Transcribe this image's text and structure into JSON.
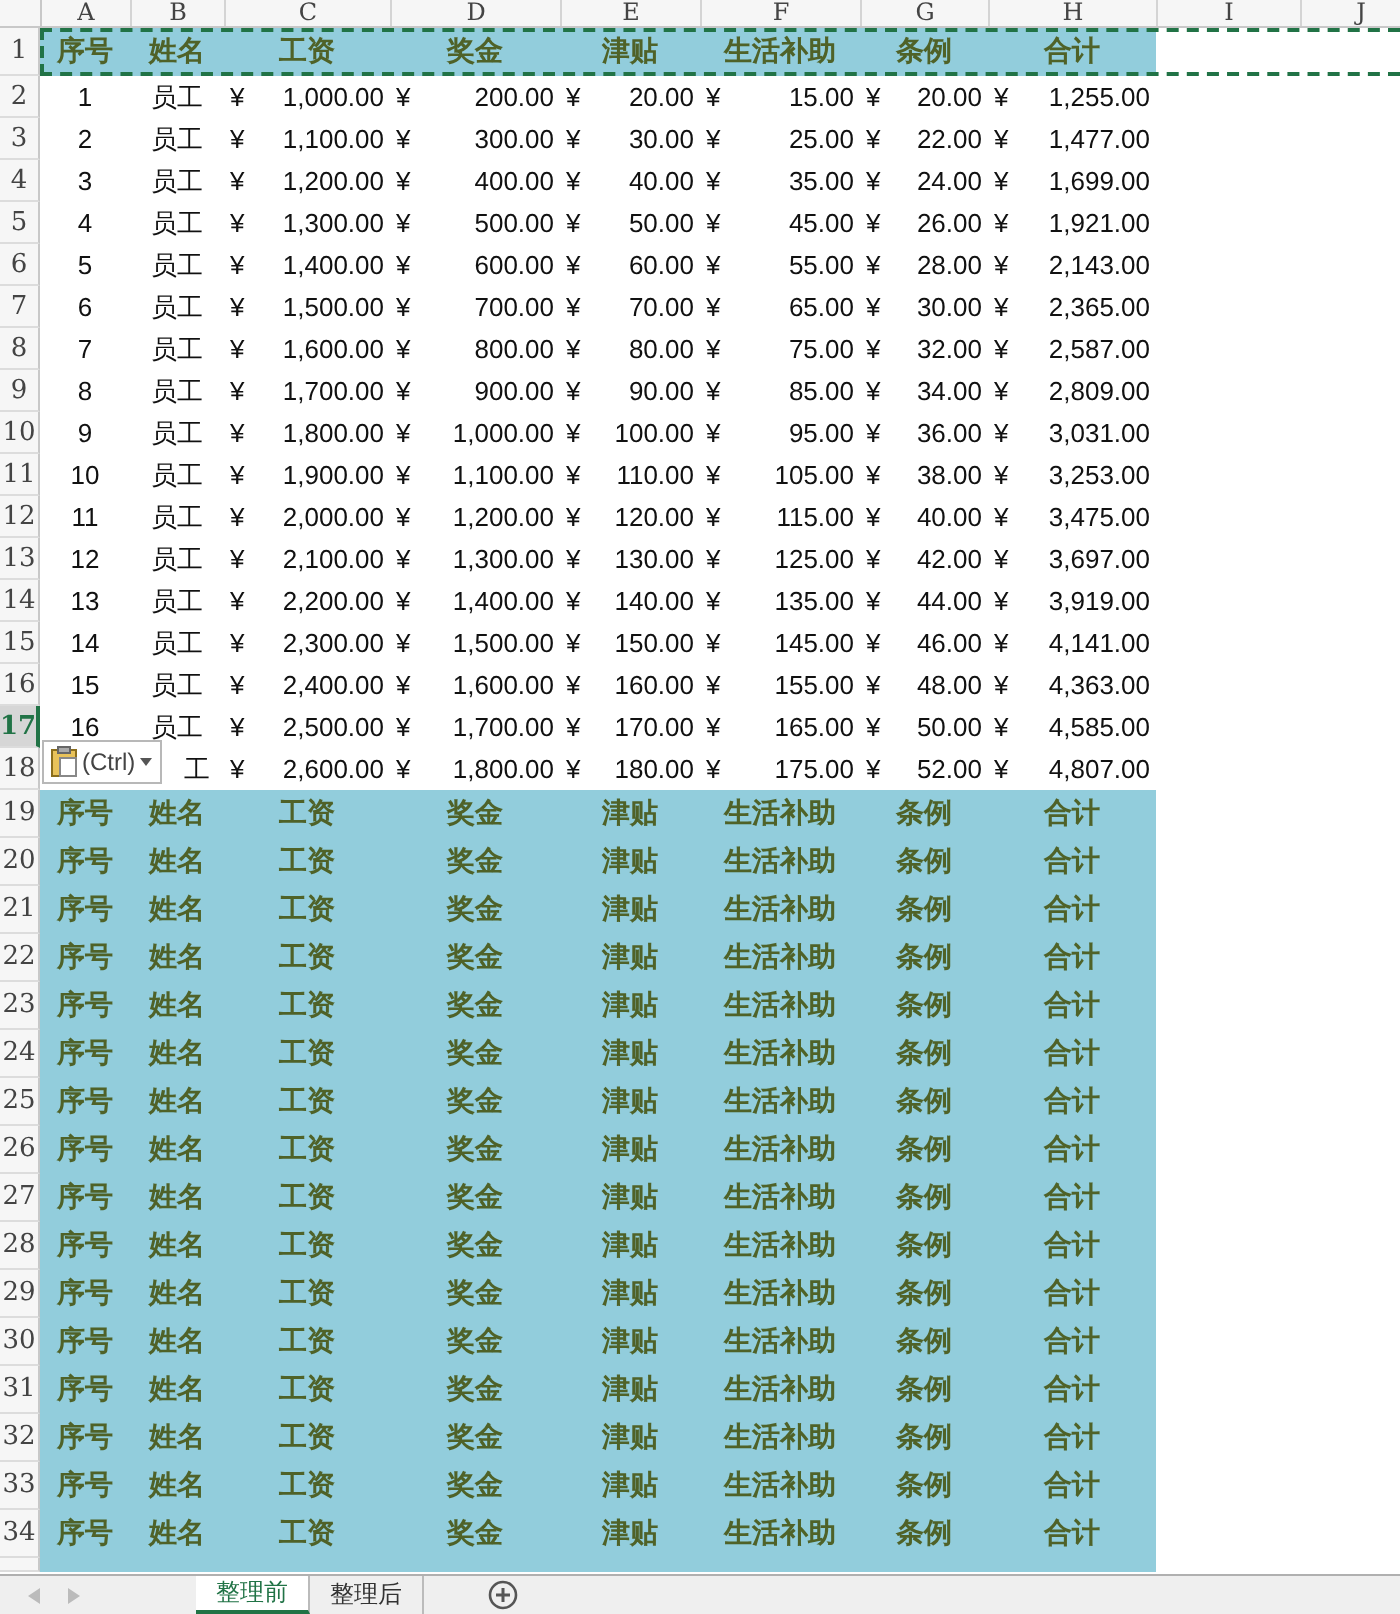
{
  "column_headers": [
    {
      "label": "A"
    },
    {
      "label": "B"
    },
    {
      "label": "C"
    },
    {
      "label": "D"
    },
    {
      "label": "E"
    },
    {
      "label": "F"
    },
    {
      "label": "G"
    },
    {
      "label": "H"
    },
    {
      "label": "I"
    },
    {
      "label": "J"
    }
  ],
  "rows": [
    {
      "number": "1",
      "selected": false,
      "copied": true,
      "kind": "header",
      "cells": [
        {
          "text": "序号"
        },
        {
          "text": "姓名"
        },
        {
          "text": "工资"
        },
        {
          "text": "奖金"
        },
        {
          "text": "津贴"
        },
        {
          "text": "生活补助"
        },
        {
          "text": "条例"
        },
        {
          "text": "合计"
        }
      ]
    },
    {
      "number": "2",
      "selected": false,
      "copied": false,
      "kind": "data",
      "cells": [
        {
          "text": "1"
        },
        {
          "text": "员工"
        },
        {
          "symbol": "¥",
          "amount": "1,000.00"
        },
        {
          "symbol": "¥",
          "amount": "200.00"
        },
        {
          "symbol": "¥",
          "amount": "20.00"
        },
        {
          "symbol": "¥",
          "amount": "15.00"
        },
        {
          "symbol": "¥",
          "amount": "20.00"
        },
        {
          "symbol": "¥",
          "amount": "1,255.00"
        }
      ]
    },
    {
      "number": "3",
      "selected": false,
      "copied": false,
      "kind": "data",
      "cells": [
        {
          "text": "2"
        },
        {
          "text": "员工"
        },
        {
          "symbol": "¥",
          "amount": "1,100.00"
        },
        {
          "symbol": "¥",
          "amount": "300.00"
        },
        {
          "symbol": "¥",
          "amount": "30.00"
        },
        {
          "symbol": "¥",
          "amount": "25.00"
        },
        {
          "symbol": "¥",
          "amount": "22.00"
        },
        {
          "symbol": "¥",
          "amount": "1,477.00"
        }
      ]
    },
    {
      "number": "4",
      "selected": false,
      "copied": false,
      "kind": "data",
      "cells": [
        {
          "text": "3"
        },
        {
          "text": "员工"
        },
        {
          "symbol": "¥",
          "amount": "1,200.00"
        },
        {
          "symbol": "¥",
          "amount": "400.00"
        },
        {
          "symbol": "¥",
          "amount": "40.00"
        },
        {
          "symbol": "¥",
          "amount": "35.00"
        },
        {
          "symbol": "¥",
          "amount": "24.00"
        },
        {
          "symbol": "¥",
          "amount": "1,699.00"
        }
      ]
    },
    {
      "number": "5",
      "selected": false,
      "copied": false,
      "kind": "data",
      "cells": [
        {
          "text": "4"
        },
        {
          "text": "员工"
        },
        {
          "symbol": "¥",
          "amount": "1,300.00"
        },
        {
          "symbol": "¥",
          "amount": "500.00"
        },
        {
          "symbol": "¥",
          "amount": "50.00"
        },
        {
          "symbol": "¥",
          "amount": "45.00"
        },
        {
          "symbol": "¥",
          "amount": "26.00"
        },
        {
          "symbol": "¥",
          "amount": "1,921.00"
        }
      ]
    },
    {
      "number": "6",
      "selected": false,
      "copied": false,
      "kind": "data",
      "cells": [
        {
          "text": "5"
        },
        {
          "text": "员工"
        },
        {
          "symbol": "¥",
          "amount": "1,400.00"
        },
        {
          "symbol": "¥",
          "amount": "600.00"
        },
        {
          "symbol": "¥",
          "amount": "60.00"
        },
        {
          "symbol": "¥",
          "amount": "55.00"
        },
        {
          "symbol": "¥",
          "amount": "28.00"
        },
        {
          "symbol": "¥",
          "amount": "2,143.00"
        }
      ]
    },
    {
      "number": "7",
      "selected": false,
      "copied": false,
      "kind": "data",
      "cells": [
        {
          "text": "6"
        },
        {
          "text": "员工"
        },
        {
          "symbol": "¥",
          "amount": "1,500.00"
        },
        {
          "symbol": "¥",
          "amount": "700.00"
        },
        {
          "symbol": "¥",
          "amount": "70.00"
        },
        {
          "symbol": "¥",
          "amount": "65.00"
        },
        {
          "symbol": "¥",
          "amount": "30.00"
        },
        {
          "symbol": "¥",
          "amount": "2,365.00"
        }
      ]
    },
    {
      "number": "8",
      "selected": false,
      "copied": false,
      "kind": "data",
      "cells": [
        {
          "text": "7"
        },
        {
          "text": "员工"
        },
        {
          "symbol": "¥",
          "amount": "1,600.00"
        },
        {
          "symbol": "¥",
          "amount": "800.00"
        },
        {
          "symbol": "¥",
          "amount": "80.00"
        },
        {
          "symbol": "¥",
          "amount": "75.00"
        },
        {
          "symbol": "¥",
          "amount": "32.00"
        },
        {
          "symbol": "¥",
          "amount": "2,587.00"
        }
      ]
    },
    {
      "number": "9",
      "selected": false,
      "copied": false,
      "kind": "data",
      "cells": [
        {
          "text": "8"
        },
        {
          "text": "员工"
        },
        {
          "symbol": "¥",
          "amount": "1,700.00"
        },
        {
          "symbol": "¥",
          "amount": "900.00"
        },
        {
          "symbol": "¥",
          "amount": "90.00"
        },
        {
          "symbol": "¥",
          "amount": "85.00"
        },
        {
          "symbol": "¥",
          "amount": "34.00"
        },
        {
          "symbol": "¥",
          "amount": "2,809.00"
        }
      ]
    },
    {
      "number": "10",
      "selected": false,
      "copied": false,
      "kind": "data",
      "cells": [
        {
          "text": "9"
        },
        {
          "text": "员工"
        },
        {
          "symbol": "¥",
          "amount": "1,800.00"
        },
        {
          "symbol": "¥",
          "amount": "1,000.00"
        },
        {
          "symbol": "¥",
          "amount": "100.00"
        },
        {
          "symbol": "¥",
          "amount": "95.00"
        },
        {
          "symbol": "¥",
          "amount": "36.00"
        },
        {
          "symbol": "¥",
          "amount": "3,031.00"
        }
      ]
    },
    {
      "number": "11",
      "selected": false,
      "copied": false,
      "kind": "data",
      "cells": [
        {
          "text": "10"
        },
        {
          "text": "员工"
        },
        {
          "symbol": "¥",
          "amount": "1,900.00"
        },
        {
          "symbol": "¥",
          "amount": "1,100.00"
        },
        {
          "symbol": "¥",
          "amount": "110.00"
        },
        {
          "symbol": "¥",
          "amount": "105.00"
        },
        {
          "symbol": "¥",
          "amount": "38.00"
        },
        {
          "symbol": "¥",
          "amount": "3,253.00"
        }
      ]
    },
    {
      "number": "12",
      "selected": false,
      "copied": false,
      "kind": "data",
      "cells": [
        {
          "text": "11"
        },
        {
          "text": "员工"
        },
        {
          "symbol": "¥",
          "amount": "2,000.00"
        },
        {
          "symbol": "¥",
          "amount": "1,200.00"
        },
        {
          "symbol": "¥",
          "amount": "120.00"
        },
        {
          "symbol": "¥",
          "amount": "115.00"
        },
        {
          "symbol": "¥",
          "amount": "40.00"
        },
        {
          "symbol": "¥",
          "amount": "3,475.00"
        }
      ]
    },
    {
      "number": "13",
      "selected": false,
      "copied": false,
      "kind": "data",
      "cells": [
        {
          "text": "12"
        },
        {
          "text": "员工"
        },
        {
          "symbol": "¥",
          "amount": "2,100.00"
        },
        {
          "symbol": "¥",
          "amount": "1,300.00"
        },
        {
          "symbol": "¥",
          "amount": "130.00"
        },
        {
          "symbol": "¥",
          "amount": "125.00"
        },
        {
          "symbol": "¥",
          "amount": "42.00"
        },
        {
          "symbol": "¥",
          "amount": "3,697.00"
        }
      ]
    },
    {
      "number": "14",
      "selected": false,
      "copied": false,
      "kind": "data",
      "cells": [
        {
          "text": "13"
        },
        {
          "text": "员工"
        },
        {
          "symbol": "¥",
          "amount": "2,200.00"
        },
        {
          "symbol": "¥",
          "amount": "1,400.00"
        },
        {
          "symbol": "¥",
          "amount": "140.00"
        },
        {
          "symbol": "¥",
          "amount": "135.00"
        },
        {
          "symbol": "¥",
          "amount": "44.00"
        },
        {
          "symbol": "¥",
          "amount": "3,919.00"
        }
      ]
    },
    {
      "number": "15",
      "selected": false,
      "copied": false,
      "kind": "data",
      "cells": [
        {
          "text": "14"
        },
        {
          "text": "员工"
        },
        {
          "symbol": "¥",
          "amount": "2,300.00"
        },
        {
          "symbol": "¥",
          "amount": "1,500.00"
        },
        {
          "symbol": "¥",
          "amount": "150.00"
        },
        {
          "symbol": "¥",
          "amount": "145.00"
        },
        {
          "symbol": "¥",
          "amount": "46.00"
        },
        {
          "symbol": "¥",
          "amount": "4,141.00"
        }
      ]
    },
    {
      "number": "16",
      "selected": false,
      "copied": false,
      "kind": "data",
      "cells": [
        {
          "text": "15"
        },
        {
          "text": "员工"
        },
        {
          "symbol": "¥",
          "amount": "2,400.00"
        },
        {
          "symbol": "¥",
          "amount": "1,600.00"
        },
        {
          "symbol": "¥",
          "amount": "160.00"
        },
        {
          "symbol": "¥",
          "amount": "155.00"
        },
        {
          "symbol": "¥",
          "amount": "48.00"
        },
        {
          "symbol": "¥",
          "amount": "4,363.00"
        }
      ]
    },
    {
      "number": "17",
      "selected": true,
      "copied": false,
      "kind": "data",
      "cells": [
        {
          "text": "16"
        },
        {
          "text": "员工"
        },
        {
          "symbol": "¥",
          "amount": "2,500.00"
        },
        {
          "symbol": "¥",
          "amount": "1,700.00"
        },
        {
          "symbol": "¥",
          "amount": "170.00"
        },
        {
          "symbol": "¥",
          "amount": "165.00"
        },
        {
          "symbol": "¥",
          "amount": "50.00"
        },
        {
          "symbol": "¥",
          "amount": "4,585.00"
        }
      ]
    },
    {
      "number": "18",
      "selected": false,
      "copied": false,
      "kind": "data",
      "cells": [
        null,
        {
          "text": "工"
        },
        {
          "symbol": "¥",
          "amount": "2,600.00"
        },
        {
          "symbol": "¥",
          "amount": "1,800.00"
        },
        {
          "symbol": "¥",
          "amount": "180.00"
        },
        {
          "symbol": "¥",
          "amount": "175.00"
        },
        {
          "symbol": "¥",
          "amount": "52.00"
        },
        {
          "symbol": "¥",
          "amount": "4,807.00"
        }
      ]
    },
    {
      "number": "19",
      "selected": false,
      "copied": false,
      "kind": "header",
      "cells": [
        {
          "text": "序号"
        },
        {
          "text": "姓名"
        },
        {
          "text": "工资"
        },
        {
          "text": "奖金"
        },
        {
          "text": "津贴"
        },
        {
          "text": "生活补助"
        },
        {
          "text": "条例"
        },
        {
          "text": "合计"
        }
      ]
    },
    {
      "number": "20",
      "selected": false,
      "copied": false,
      "kind": "header",
      "cells": [
        {
          "text": "序号"
        },
        {
          "text": "姓名"
        },
        {
          "text": "工资"
        },
        {
          "text": "奖金"
        },
        {
          "text": "津贴"
        },
        {
          "text": "生活补助"
        },
        {
          "text": "条例"
        },
        {
          "text": "合计"
        }
      ]
    },
    {
      "number": "21",
      "selected": false,
      "copied": false,
      "kind": "header",
      "cells": [
        {
          "text": "序号"
        },
        {
          "text": "姓名"
        },
        {
          "text": "工资"
        },
        {
          "text": "奖金"
        },
        {
          "text": "津贴"
        },
        {
          "text": "生活补助"
        },
        {
          "text": "条例"
        },
        {
          "text": "合计"
        }
      ]
    },
    {
      "number": "22",
      "selected": false,
      "copied": false,
      "kind": "header",
      "cells": [
        {
          "text": "序号"
        },
        {
          "text": "姓名"
        },
        {
          "text": "工资"
        },
        {
          "text": "奖金"
        },
        {
          "text": "津贴"
        },
        {
          "text": "生活补助"
        },
        {
          "text": "条例"
        },
        {
          "text": "合计"
        }
      ]
    },
    {
      "number": "23",
      "selected": false,
      "copied": false,
      "kind": "header",
      "cells": [
        {
          "text": "序号"
        },
        {
          "text": "姓名"
        },
        {
          "text": "工资"
        },
        {
          "text": "奖金"
        },
        {
          "text": "津贴"
        },
        {
          "text": "生活补助"
        },
        {
          "text": "条例"
        },
        {
          "text": "合计"
        }
      ]
    },
    {
      "number": "24",
      "selected": false,
      "copied": false,
      "kind": "header",
      "cells": [
        {
          "text": "序号"
        },
        {
          "text": "姓名"
        },
        {
          "text": "工资"
        },
        {
          "text": "奖金"
        },
        {
          "text": "津贴"
        },
        {
          "text": "生活补助"
        },
        {
          "text": "条例"
        },
        {
          "text": "合计"
        }
      ]
    },
    {
      "number": "25",
      "selected": false,
      "copied": false,
      "kind": "header",
      "cells": [
        {
          "text": "序号"
        },
        {
          "text": "姓名"
        },
        {
          "text": "工资"
        },
        {
          "text": "奖金"
        },
        {
          "text": "津贴"
        },
        {
          "text": "生活补助"
        },
        {
          "text": "条例"
        },
        {
          "text": "合计"
        }
      ]
    },
    {
      "number": "26",
      "selected": false,
      "copied": false,
      "kind": "header",
      "cells": [
        {
          "text": "序号"
        },
        {
          "text": "姓名"
        },
        {
          "text": "工资"
        },
        {
          "text": "奖金"
        },
        {
          "text": "津贴"
        },
        {
          "text": "生活补助"
        },
        {
          "text": "条例"
        },
        {
          "text": "合计"
        }
      ]
    },
    {
      "number": "27",
      "selected": false,
      "copied": false,
      "kind": "header",
      "cells": [
        {
          "text": "序号"
        },
        {
          "text": "姓名"
        },
        {
          "text": "工资"
        },
        {
          "text": "奖金"
        },
        {
          "text": "津贴"
        },
        {
          "text": "生活补助"
        },
        {
          "text": "条例"
        },
        {
          "text": "合计"
        }
      ]
    },
    {
      "number": "28",
      "selected": false,
      "copied": false,
      "kind": "header",
      "cells": [
        {
          "text": "序号"
        },
        {
          "text": "姓名"
        },
        {
          "text": "工资"
        },
        {
          "text": "奖金"
        },
        {
          "text": "津贴"
        },
        {
          "text": "生活补助"
        },
        {
          "text": "条例"
        },
        {
          "text": "合计"
        }
      ]
    },
    {
      "number": "29",
      "selected": false,
      "copied": false,
      "kind": "header",
      "cells": [
        {
          "text": "序号"
        },
        {
          "text": "姓名"
        },
        {
          "text": "工资"
        },
        {
          "text": "奖金"
        },
        {
          "text": "津贴"
        },
        {
          "text": "生活补助"
        },
        {
          "text": "条例"
        },
        {
          "text": "合计"
        }
      ]
    },
    {
      "number": "30",
      "selected": false,
      "copied": false,
      "kind": "header",
      "cells": [
        {
          "text": "序号"
        },
        {
          "text": "姓名"
        },
        {
          "text": "工资"
        },
        {
          "text": "奖金"
        },
        {
          "text": "津贴"
        },
        {
          "text": "生活补助"
        },
        {
          "text": "条例"
        },
        {
          "text": "合计"
        }
      ]
    },
    {
      "number": "31",
      "selected": false,
      "copied": false,
      "kind": "header",
      "cells": [
        {
          "text": "序号"
        },
        {
          "text": "姓名"
        },
        {
          "text": "工资"
        },
        {
          "text": "奖金"
        },
        {
          "text": "津贴"
        },
        {
          "text": "生活补助"
        },
        {
          "text": "条例"
        },
        {
          "text": "合计"
        }
      ]
    },
    {
      "number": "32",
      "selected": false,
      "copied": false,
      "kind": "header",
      "cells": [
        {
          "text": "序号"
        },
        {
          "text": "姓名"
        },
        {
          "text": "工资"
        },
        {
          "text": "奖金"
        },
        {
          "text": "津贴"
        },
        {
          "text": "生活补助"
        },
        {
          "text": "条例"
        },
        {
          "text": "合计"
        }
      ]
    },
    {
      "number": "33",
      "selected": false,
      "copied": false,
      "kind": "header",
      "cells": [
        {
          "text": "序号"
        },
        {
          "text": "姓名"
        },
        {
          "text": "工资"
        },
        {
          "text": "奖金"
        },
        {
          "text": "津贴"
        },
        {
          "text": "生活补助"
        },
        {
          "text": "条例"
        },
        {
          "text": "合计"
        }
      ]
    },
    {
      "number": "34",
      "selected": false,
      "copied": false,
      "kind": "header",
      "cells": [
        {
          "text": "序号"
        },
        {
          "text": "姓名"
        },
        {
          "text": "工资"
        },
        {
          "text": "奖金"
        },
        {
          "text": "津贴"
        },
        {
          "text": "生活补助"
        },
        {
          "text": "条例"
        },
        {
          "text": "合计"
        }
      ]
    }
  ],
  "paste_options": {
    "label": "(Ctrl)"
  },
  "sheet_tabs": [
    {
      "label": "整理前",
      "selected": true
    },
    {
      "label": "整理后",
      "selected": false
    }
  ]
}
